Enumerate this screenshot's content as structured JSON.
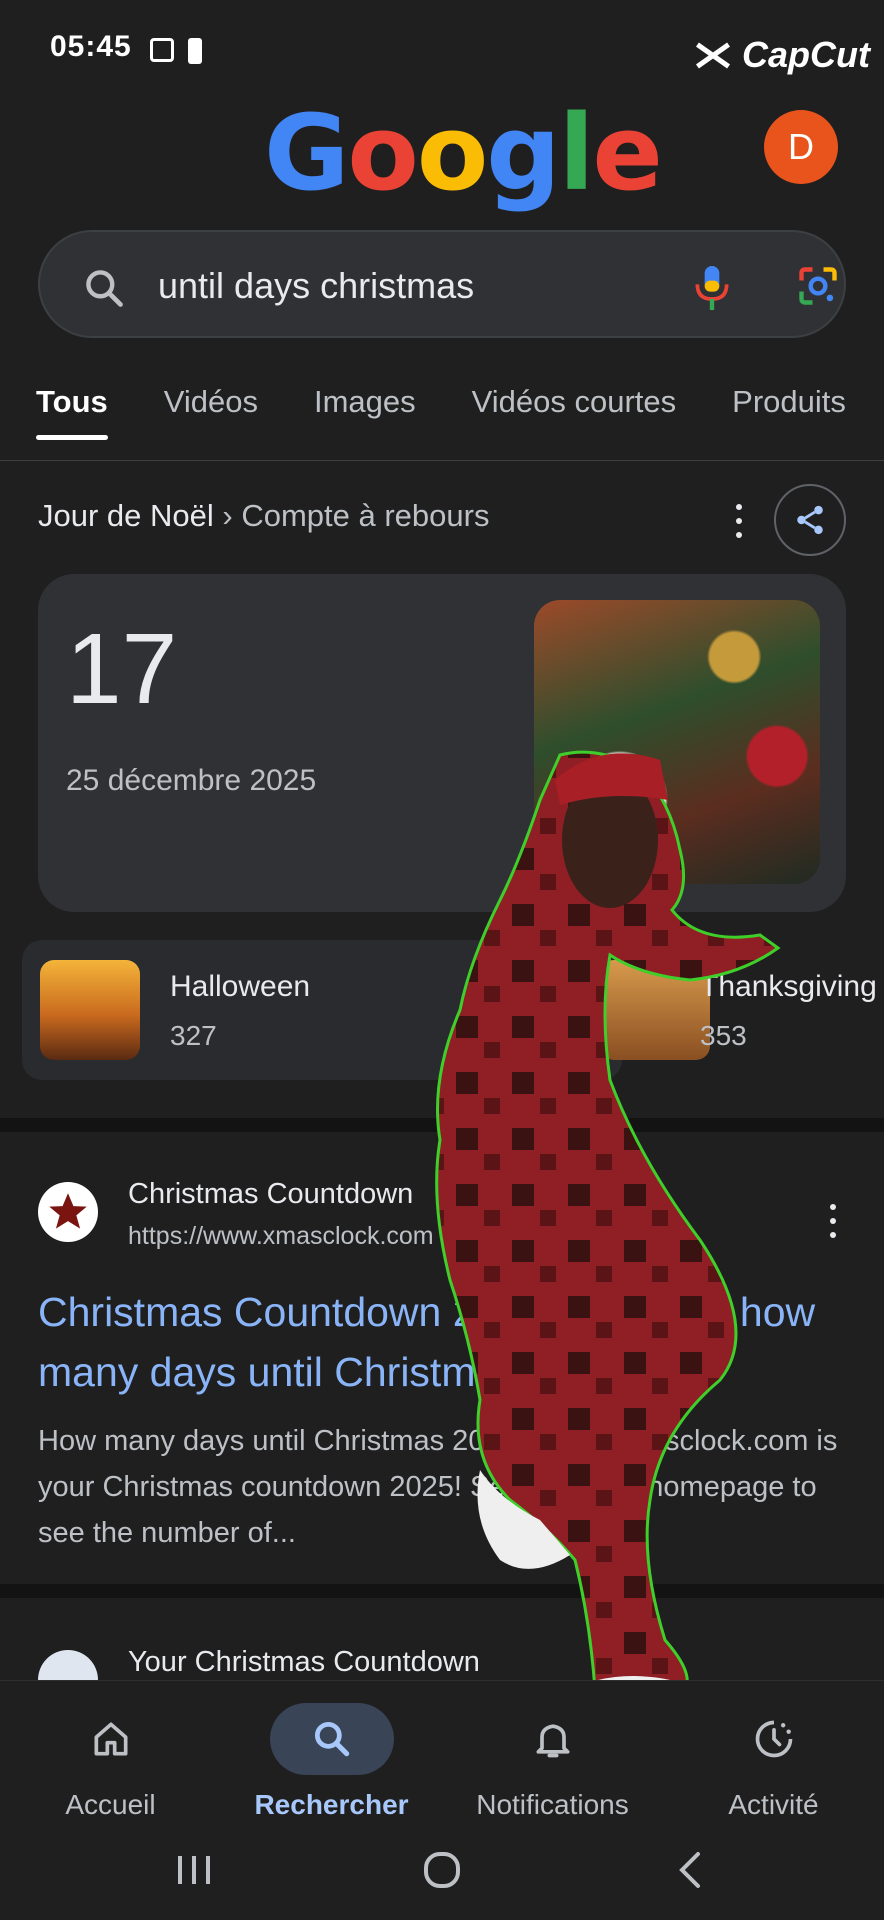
{
  "status_bar": {
    "time": "05:45"
  },
  "capcut": {
    "label": "CapCut"
  },
  "google_logo": {
    "letters": [
      "G",
      "o",
      "o",
      "g",
      "l",
      "e"
    ]
  },
  "account": {
    "initial": "D"
  },
  "search": {
    "query": "until days christmas"
  },
  "tabs": [
    {
      "label": "Tous",
      "active": true
    },
    {
      "label": "Vidéos"
    },
    {
      "label": "Images"
    },
    {
      "label": "Vidéos courtes"
    },
    {
      "label": "Produits"
    }
  ],
  "breadcrumb": {
    "title": "Jour de Noël",
    "separator": " › ",
    "subtitle": "Compte à rebours"
  },
  "countdown": {
    "days": "17",
    "date": "25 décembre 2025"
  },
  "holidays": [
    {
      "name": "Halloween",
      "days": "327"
    },
    {
      "name": "Thanksgiving",
      "days": "353"
    }
  ],
  "results": [
    {
      "site_name": "Christmas Countdown",
      "url": "https://www.xmasclock.com",
      "title": "Christmas Countdown 2025 - Find out how many days until Christmas 2025",
      "snippet": "How many days until Christmas 2025? www.xmasclock.com is your Christmas countdown 2025! Set it as your homepage to see the number of..."
    },
    {
      "site_name": "Your Christmas Countdown"
    }
  ],
  "bottom_nav": [
    {
      "label": "Accueil",
      "icon": "home-icon"
    },
    {
      "label": "Rechercher",
      "icon": "search-icon",
      "active": true
    },
    {
      "label": "Notifications",
      "icon": "bell-icon"
    },
    {
      "label": "Activité",
      "icon": "activity-icon"
    }
  ],
  "colors": {
    "background": "#1f1f1f",
    "link": "#8ab4f8",
    "avatar": "#e8541c",
    "nav_active": "#a8c7fa"
  }
}
